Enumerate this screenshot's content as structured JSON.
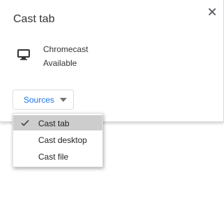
{
  "dialog": {
    "title": "Cast tab",
    "close_icon": "close-icon"
  },
  "sink": {
    "icon": "monitor-icon",
    "name": "Chromecast",
    "status": "Available"
  },
  "sources_button": {
    "label": "Sources",
    "icon": "caret-down-icon",
    "label_color": "#1a73e8"
  },
  "sources_menu": {
    "items": [
      {
        "label": "Cast tab",
        "selected": true
      },
      {
        "label": "Cast desktop",
        "selected": false
      },
      {
        "label": "Cast file",
        "selected": false
      }
    ],
    "selected_bg": "#cdcdcd"
  }
}
